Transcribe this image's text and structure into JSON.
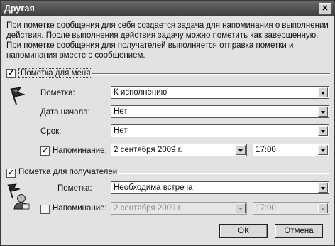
{
  "window": {
    "title": "Другая",
    "close_glyph": "✕"
  },
  "description": "При пометке сообщения для себя создается задача для напоминания о выполнении действия. После выполнения действия задачу можно пометить как завершенную. При пометке сообщения для получателей выполняется отправка пометки и напоминания вместе с сообщением.",
  "for_me": {
    "checked": true,
    "label": "Пометка для меня",
    "icon": "flag-icon",
    "flag_label": "Пометка:",
    "flag_value": "К исполнению",
    "start_label": "Дата начала:",
    "start_value": "Нет",
    "due_label": "Срок:",
    "due_value": "Нет",
    "reminder_checked": true,
    "reminder_label": "Напоминание:",
    "reminder_date": "2 сентября 2009 г.",
    "reminder_time": "17:00"
  },
  "for_recipients": {
    "checked": true,
    "label": "Пометка для получателей",
    "icon": "recipient-flag-icon",
    "flag_label": "Пометка:",
    "flag_value": "Необходима встреча",
    "reminder_checked": false,
    "reminder_label": "Напоминание:",
    "reminder_date": "2 сентября 2009 г.",
    "reminder_time": "17:00"
  },
  "buttons": {
    "ok": "ОК",
    "cancel": "Отмена"
  },
  "check_glyph": "✓"
}
